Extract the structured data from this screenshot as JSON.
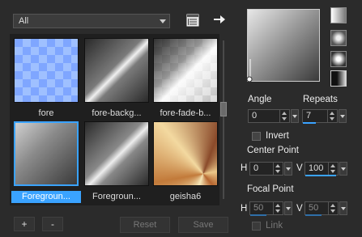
{
  "category": {
    "selected": "All"
  },
  "toolbar": {
    "list_icon": "list-icon",
    "arrow_icon": "arrow-right-icon"
  },
  "thumbnails": [
    {
      "label": "fore",
      "selected": false
    },
    {
      "label": "fore-backg...",
      "selected": false
    },
    {
      "label": "fore-fade-b...",
      "selected": false
    },
    {
      "label": "Foregroun...",
      "selected": true
    },
    {
      "label": "Foregroun...",
      "selected": false
    },
    {
      "label": "geisha6",
      "selected": false
    }
  ],
  "bottom_buttons": {
    "add": "+",
    "remove": "-",
    "reset": "Reset",
    "save": "Save"
  },
  "settings": {
    "angle_label": "Angle",
    "angle_value": "0",
    "repeats_label": "Repeats",
    "repeats_value": "7",
    "invert_label": "Invert",
    "center_point_label": "Center Point",
    "center_h_label": "H",
    "center_h_value": "0",
    "center_v_label": "V",
    "center_v_value": "100",
    "focal_point_label": "Focal Point",
    "focal_h_label": "H",
    "focal_h_value": "50",
    "focal_v_label": "V",
    "focal_v_value": "50",
    "link_label": "Link"
  },
  "accent_color": "#3aa3ff"
}
